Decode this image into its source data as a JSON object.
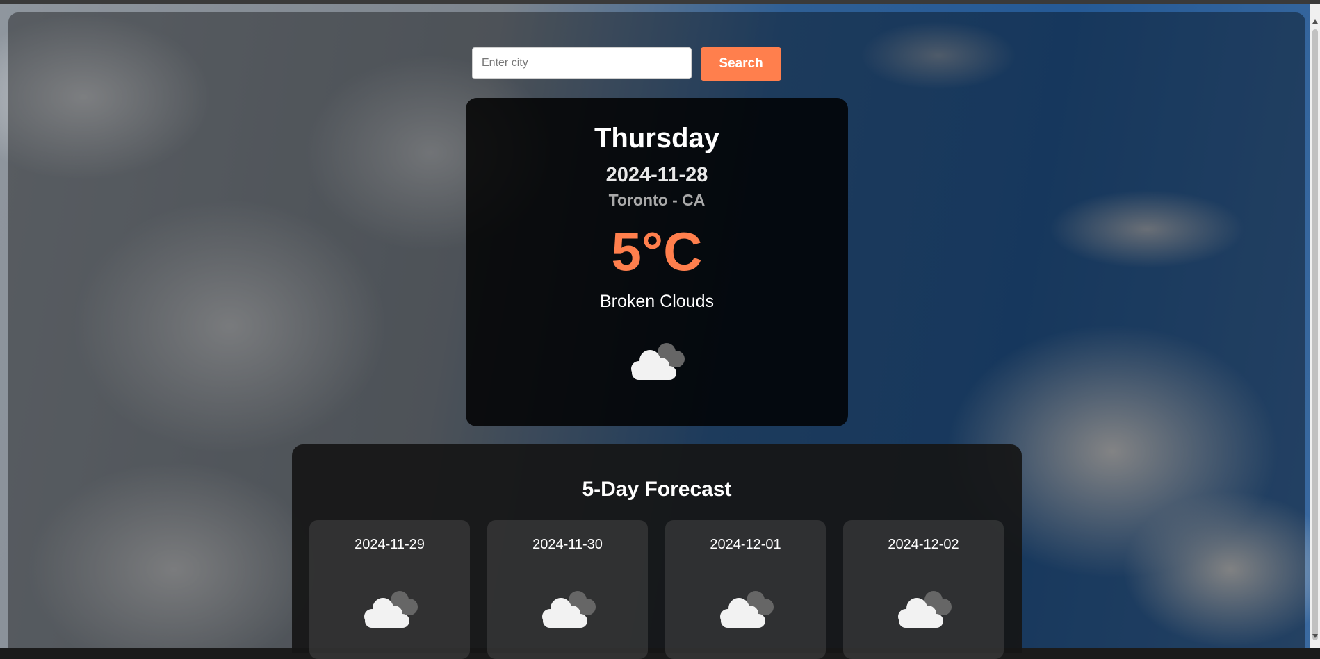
{
  "search": {
    "placeholder": "Enter city",
    "value": "",
    "button_label": "Search"
  },
  "current": {
    "day": "Thursday",
    "date": "2024-11-28",
    "location": "Toronto - CA",
    "temperature": "5°C",
    "description": "Broken Clouds",
    "icon": "broken-clouds-icon"
  },
  "forecast": {
    "title": "5-Day Forecast",
    "days": [
      {
        "date": "2024-11-29",
        "icon": "broken-clouds-icon"
      },
      {
        "date": "2024-11-30",
        "icon": "broken-clouds-icon"
      },
      {
        "date": "2024-12-01",
        "icon": "broken-clouds-icon"
      },
      {
        "date": "2024-12-02",
        "icon": "broken-clouds-icon"
      }
    ]
  },
  "colors": {
    "accent": "#ff7f4d",
    "card": "#000000",
    "text": "#ffffff"
  }
}
